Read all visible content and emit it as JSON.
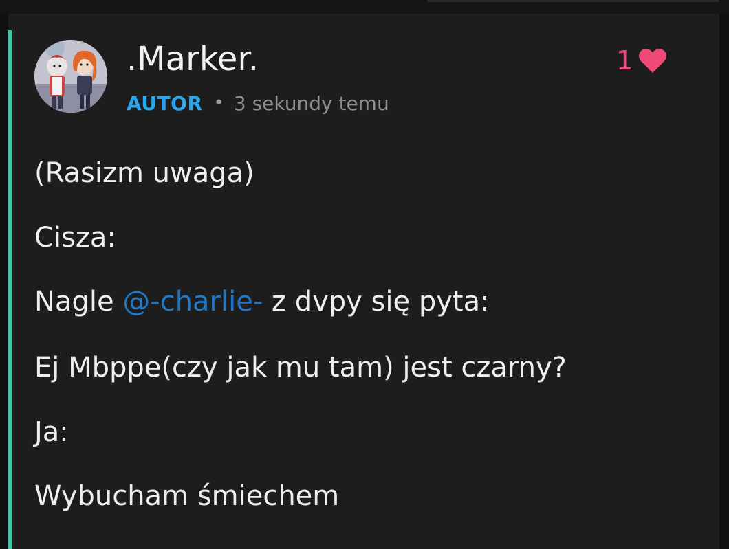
{
  "comment": {
    "author": {
      "name": ".Marker.",
      "role": "AUTOR"
    },
    "separator": "•",
    "timestamp": "3 sekundy temu",
    "likes": {
      "count": "1",
      "icon": "heart-icon",
      "color": "#ef4a77"
    },
    "body": {
      "line1": "(Rasizm uwaga)",
      "line2": "Cisza:",
      "line3": {
        "before": "Nagle ",
        "mention": "@-charlie-",
        "after": " z dvpy się pyta:"
      },
      "line4": "Ej Mbppe(czy jak mu tam) jest czarny?",
      "line5": "Ja:",
      "line6": "Wybucham śmiechem"
    },
    "colors": {
      "accent": "#3ec9a7",
      "role": "#2aa7ef",
      "mention": "#1f78c8",
      "card_background": "#1d1d1d"
    }
  }
}
